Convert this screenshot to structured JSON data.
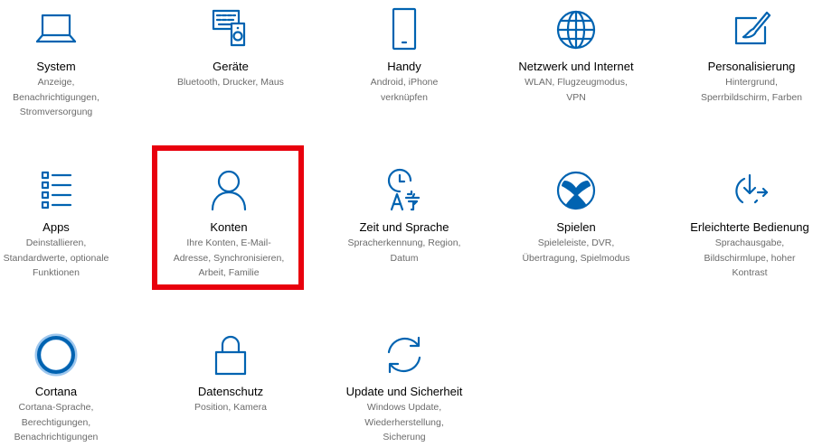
{
  "colors": {
    "accent": "#0063b1",
    "highlight": "#e8000d",
    "title_text": "#000000",
    "description_text": "#6b6b6b"
  },
  "categories": [
    {
      "id": "system",
      "icon": "laptop-icon",
      "title": "System",
      "description": "Anzeige,\nBenachrichtigungen,\nStromversorgung"
    },
    {
      "id": "devices",
      "icon": "devices-icon",
      "title": "Geräte",
      "description": "Bluetooth, Drucker, Maus"
    },
    {
      "id": "phone",
      "icon": "phone-icon",
      "title": "Handy",
      "description": "Android, iPhone\nverknüpfen"
    },
    {
      "id": "network",
      "icon": "globe-icon",
      "title": "Netzwerk und Internet",
      "description": "WLAN, Flugzeugmodus,\nVPN"
    },
    {
      "id": "personalization",
      "icon": "paintbrush-icon",
      "title": "Personalisierung",
      "description": "Hintergrund,\nSperrbildschirm, Farben"
    },
    {
      "id": "apps",
      "icon": "apps-list-icon",
      "title": "Apps",
      "description": "Deinstallieren,\nStandardwerte, optionale\nFunktionen"
    },
    {
      "id": "accounts",
      "icon": "person-icon",
      "title": "Konten",
      "description": "Ihre Konten, E-Mail-\nAdresse, Synchronisieren,\nArbeit, Familie"
    },
    {
      "id": "time-language",
      "icon": "time-language-icon",
      "title": "Zeit und Sprache",
      "description": "Spracherkennung, Region,\nDatum"
    },
    {
      "id": "gaming",
      "icon": "xbox-icon",
      "title": "Spielen",
      "description": "Spieleleiste, DVR,\nÜbertragung, Spielmodus"
    },
    {
      "id": "ease-of-access",
      "icon": "ease-of-access-icon",
      "title": "Erleichterte Bedienung",
      "description": "Sprachausgabe,\nBildschirmlupe, hoher\nKontrast"
    },
    {
      "id": "cortana",
      "icon": "cortana-icon",
      "title": "Cortana",
      "description": "Cortana-Sprache,\nBerechtigungen,\nBenachrichtigungen"
    },
    {
      "id": "privacy",
      "icon": "lock-icon",
      "title": "Datenschutz",
      "description": "Position, Kamera"
    },
    {
      "id": "update",
      "icon": "sync-icon",
      "title": "Update und Sicherheit",
      "description": "Windows Update,\nWiederherstellung,\nSicherung"
    }
  ],
  "highlighted_category": "accounts"
}
